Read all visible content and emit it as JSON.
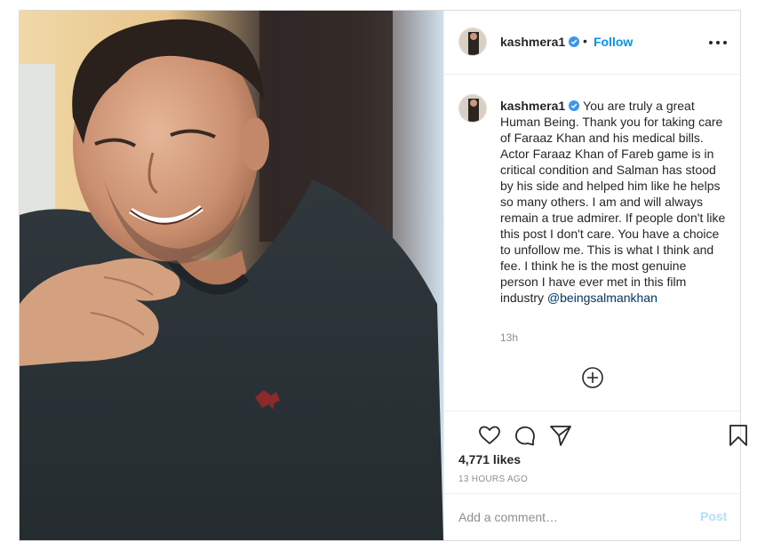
{
  "post": {
    "username": "kashmera1",
    "verified": true,
    "follow_label": "Follow",
    "separator": "•",
    "caption": "You are truly a great Human Being. Thank you for taking care of Faraaz Khan and his medical bills. Actor Faraaz Khan of Fareb game is in critical condition and Salman has stood by his side and helped him like he helps so many others. I am and will always remain a true admirer. If people don't like this post I don't care. You have a choice to unfollow me. This is what I think and fee. I think he is the most genuine person I have ever met in this film industry",
    "mention": "@beingsalmankhan",
    "caption_time": "13h",
    "likes": "4,771 likes",
    "posted": "13 HOURS AGO"
  },
  "comment_box": {
    "placeholder": "Add a comment…",
    "post_label": "Post"
  },
  "icons": {
    "verified": "verified-badge-icon",
    "more": "more-options-icon",
    "load_more": "plus-circle-icon",
    "like": "heart-icon",
    "comment": "comment-bubble-icon",
    "share": "paper-plane-icon",
    "save": "bookmark-icon"
  },
  "colors": {
    "accent": "#0095f6",
    "verified": "#3897f0",
    "post_disabled": "#b2dffc",
    "muted": "#8e8e8e",
    "mention": "#00376b",
    "shirt": "#2a3136"
  }
}
